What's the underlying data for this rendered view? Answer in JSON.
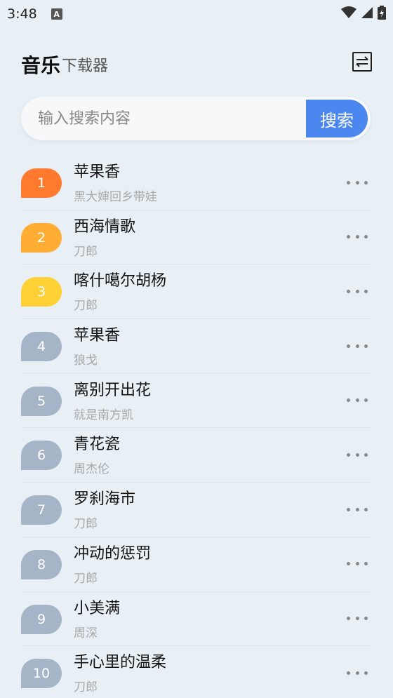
{
  "status_bar": {
    "time": "3:48",
    "notification_icon": "A"
  },
  "header": {
    "title_main": "音乐",
    "title_sub": "下载器",
    "switch_icon": "swap-icon"
  },
  "search": {
    "placeholder": "输入搜索内容",
    "value": "",
    "button_label": "搜索"
  },
  "colors": {
    "rank_1": "#ff7a2e",
    "rank_2": "#ffae33",
    "rank_3": "#fdd036",
    "rank_other": "#a6b4c8",
    "search_button": "#4c87f0"
  },
  "songs": [
    {
      "rank": "1",
      "title": "苹果香",
      "artist": "黑大婶回乡带娃"
    },
    {
      "rank": "2",
      "title": "西海情歌",
      "artist": "刀郎"
    },
    {
      "rank": "3",
      "title": "喀什噶尔胡杨",
      "artist": "刀郎"
    },
    {
      "rank": "4",
      "title": "苹果香",
      "artist": "狼戈"
    },
    {
      "rank": "5",
      "title": "离别开出花",
      "artist": "就是南方凯"
    },
    {
      "rank": "6",
      "title": "青花瓷",
      "artist": "周杰伦"
    },
    {
      "rank": "7",
      "title": "罗刹海市",
      "artist": "刀郎"
    },
    {
      "rank": "8",
      "title": "冲动的惩罚",
      "artist": "刀郎"
    },
    {
      "rank": "9",
      "title": "小美满",
      "artist": "周深"
    },
    {
      "rank": "10",
      "title": "手心里的温柔",
      "artist": "刀郎"
    }
  ]
}
